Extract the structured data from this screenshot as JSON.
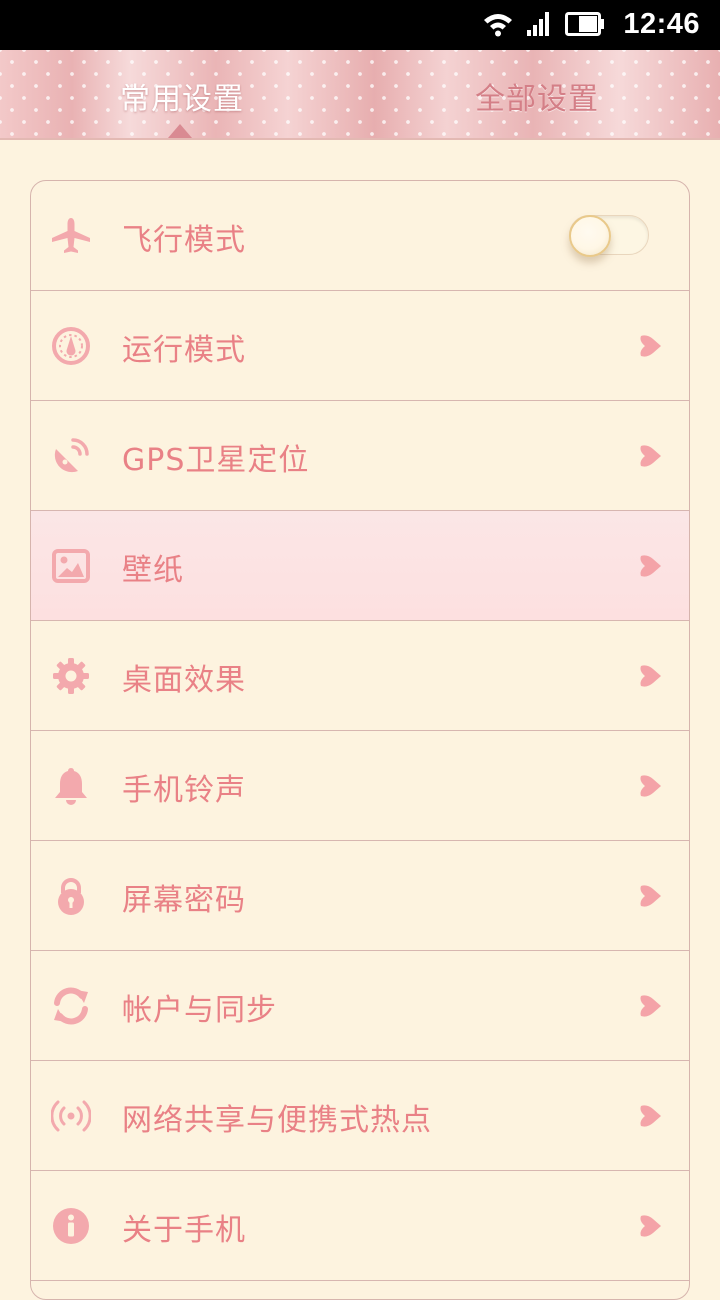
{
  "status_bar": {
    "time": "12:46",
    "icons": [
      "wifi-icon",
      "signal-icon",
      "battery-icon"
    ]
  },
  "tabs": {
    "active_label": "常用设置",
    "inactive_label": "全部设置"
  },
  "settings": {
    "items": [
      {
        "label": "飞行模式",
        "icon": "airplane-icon",
        "control": "toggle",
        "toggle_on": false
      },
      {
        "label": "运行模式",
        "icon": "gauge-icon",
        "control": "chevron"
      },
      {
        "label": "GPS卫星定位",
        "icon": "satellite-icon",
        "control": "chevron"
      },
      {
        "label": "壁纸",
        "icon": "wallpaper-icon",
        "control": "chevron",
        "highlighted": true
      },
      {
        "label": "桌面效果",
        "icon": "gear-icon",
        "control": "chevron"
      },
      {
        "label": "手机铃声",
        "icon": "bell-icon",
        "control": "chevron"
      },
      {
        "label": "屏幕密码",
        "icon": "lock-icon",
        "control": "chevron"
      },
      {
        "label": "帐户与同步",
        "icon": "sync-icon",
        "control": "chevron"
      },
      {
        "label": "网络共享与便携式热点",
        "icon": "hotspot-icon",
        "control": "chevron"
      },
      {
        "label": "关于手机",
        "icon": "info-icon",
        "control": "chevron"
      }
    ]
  },
  "colors": {
    "background": "#fdf3df",
    "accent_text": "#e98186",
    "icon": "#f3a9ad",
    "chevron": "#f4a3a8",
    "divider": "#d7b6b0"
  }
}
